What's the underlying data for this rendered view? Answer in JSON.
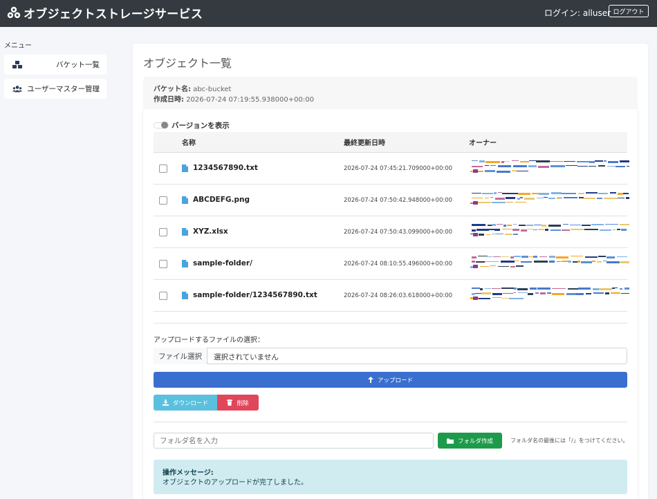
{
  "header": {
    "app_title": "オブジェクトストレージサービス",
    "login_text": "ログイン: alluser",
    "logout_label": "ログアウト"
  },
  "sidebar": {
    "menu_label": "メニュー",
    "items": [
      {
        "label": "バケット一覧",
        "icon": "boxes-icon"
      },
      {
        "label": "ユーザーマスター管理",
        "icon": "users-icon"
      }
    ]
  },
  "main": {
    "page_title": "オブジェクト一覧",
    "bucket": {
      "name_label": "バケット名:",
      "name_value": "abc-bucket",
      "created_label": "作成日時:",
      "created_value": "2026-07-24 07:19:55.938000+00:00"
    },
    "version_toggle_label": "バージョンを表示",
    "table": {
      "headers": {
        "name": "名称",
        "updated": "最終更新日時",
        "owner": "オーナー"
      },
      "rows": [
        {
          "name": "1234567890.txt",
          "updated": "2026-07-24 07:45:21.709000+00:00"
        },
        {
          "name": "ABCDEFG.png",
          "updated": "2026-07-24 07:50:42.948000+00:00"
        },
        {
          "name": "XYZ.xlsx",
          "updated": "2026-07-24 07:50:43.099000+00:00"
        },
        {
          "name": "sample-folder/",
          "updated": "2026-07-24 08:10:55.496000+00:00"
        },
        {
          "name": "sample-folder/1234567890.txt",
          "updated": "2026-07-24 08:26:03.618000+00:00"
        }
      ]
    },
    "upload": {
      "label": "アップロードするファイルの選択：",
      "file_button": "ファイル選択",
      "file_status": "選択されていません",
      "upload_button": "アップロード"
    },
    "actions": {
      "download_button": "ダウンロード",
      "delete_button": "削除"
    },
    "folder": {
      "placeholder": "フォルダ名を入力",
      "create_button": "フォルダ作成",
      "hint": "フォルダ名の最後には「/」をつけてください。"
    },
    "alert": {
      "title": "操作メッセージ:",
      "message": "オブジェクトのアップロードが完了しました。"
    }
  },
  "colors": {
    "header_bg": "#343a40",
    "primary": "#3a6fcf",
    "info": "#5bc0de",
    "danger": "#e0475b",
    "success": "#1e9a4b",
    "alert_bg": "#d1ecf1"
  }
}
